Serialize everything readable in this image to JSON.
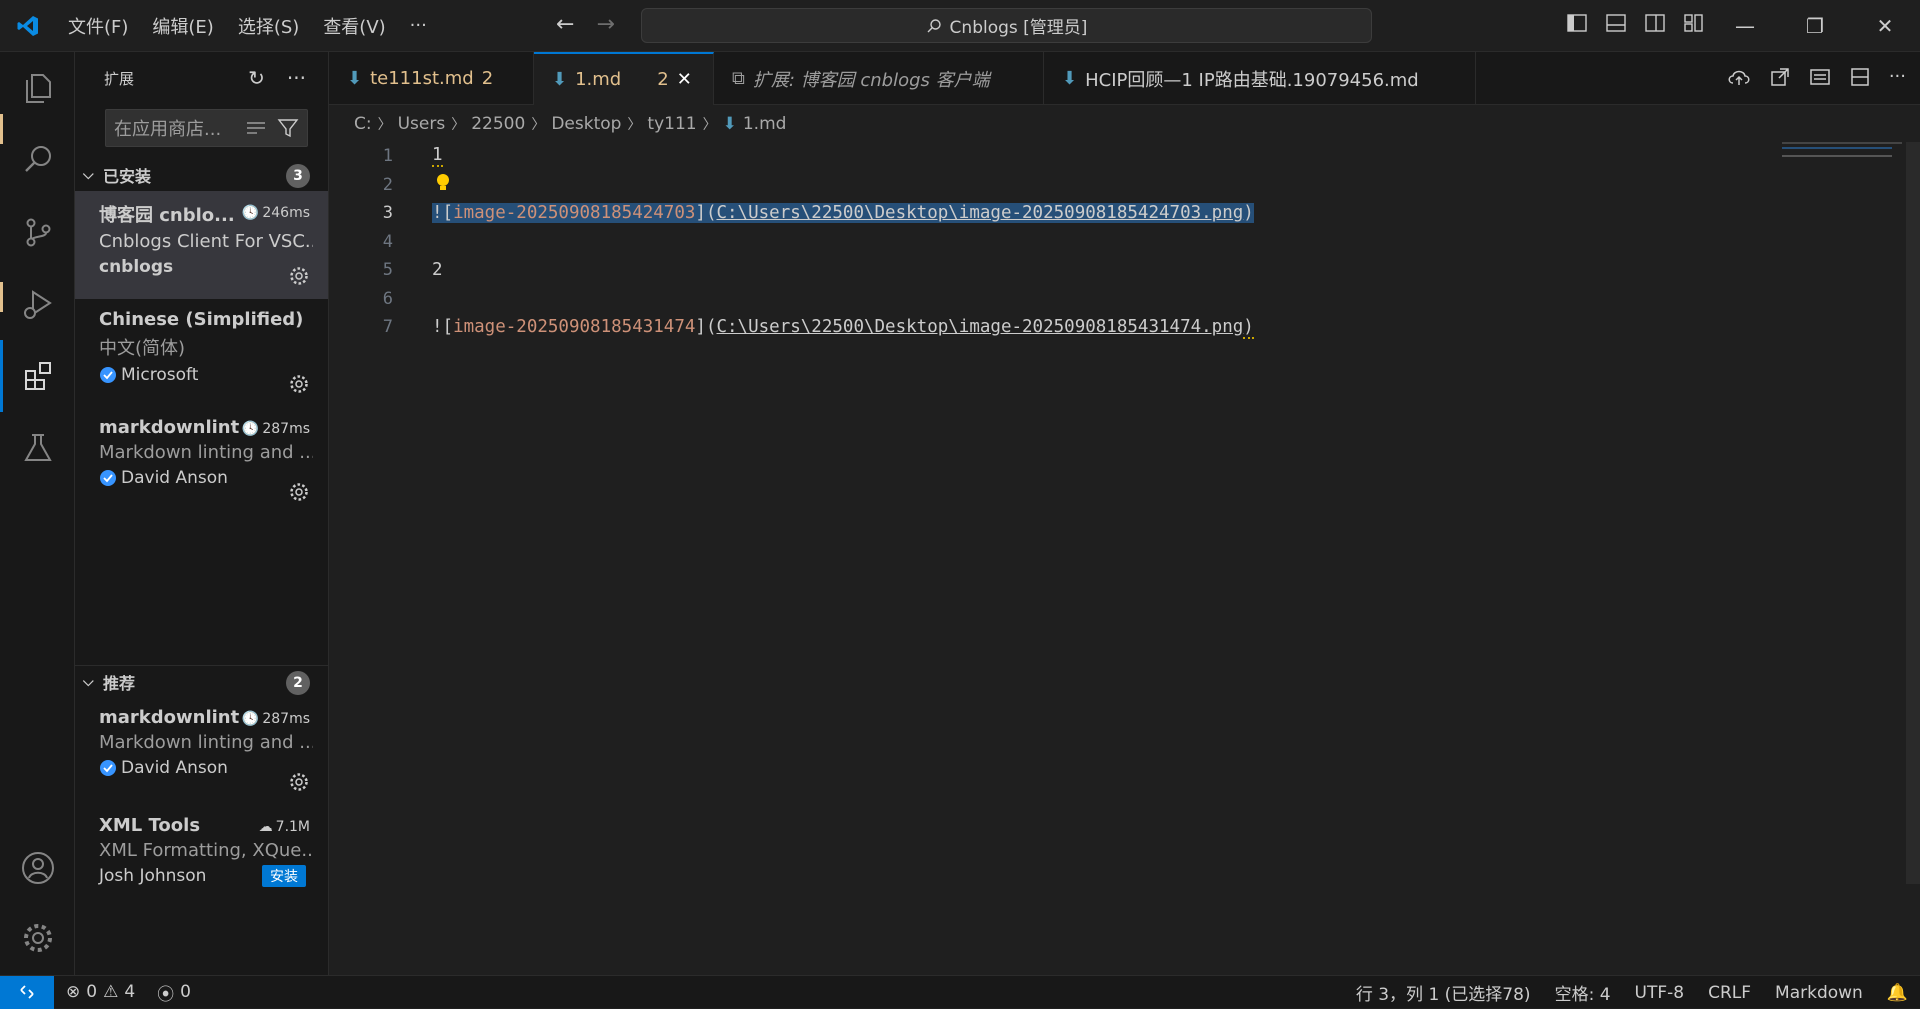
{
  "titlebar": {
    "menu": [
      "文件(F)",
      "编辑(E)",
      "选择(S)",
      "查看(V)",
      "···"
    ],
    "command_center": "Cnblogs [管理员]"
  },
  "sidebar": {
    "title": "扩展",
    "search_placeholder": "在应用商店...",
    "installed": {
      "label": "已安装",
      "count": "3",
      "items": [
        {
          "name": "博客园 cnblo...",
          "meta": "246ms",
          "desc": "Cnblogs Client For VSC...",
          "publisher": "cnblogs"
        },
        {
          "name": "Chinese (Simplified) ...",
          "meta": "",
          "desc": "中文(简体)",
          "publisher": "Microsoft"
        },
        {
          "name": "markdownlint",
          "meta": "287ms",
          "desc": "Markdown linting and ...",
          "publisher": "David Anson"
        }
      ]
    },
    "recommended": {
      "label": "推荐",
      "count": "2",
      "items": [
        {
          "name": "markdownlint",
          "meta": "287ms",
          "desc": "Markdown linting and ...",
          "publisher": "David Anson"
        },
        {
          "name": "XML Tools",
          "meta": "7.1M",
          "desc": "XML Formatting, XQue...",
          "publisher": "Josh Johnson",
          "install_label": "安装"
        }
      ]
    }
  },
  "tabs": [
    {
      "label": "te111st.md",
      "badge": "2"
    },
    {
      "label": "1.md",
      "badge": "2",
      "close": "✕"
    },
    {
      "label": "扩展: 博客园 cnblogs 客户端"
    },
    {
      "label": "HCIP回顾—1   IP路由基础.19079456.md"
    }
  ],
  "breadcrumb": [
    "C:",
    "Users",
    "22500",
    "Desktop",
    "ty111",
    "1.md"
  ],
  "editor": {
    "lines": [
      {
        "n": "1",
        "text": "1"
      },
      {
        "n": "2",
        "text": ""
      },
      {
        "n": "3",
        "alt": "image-20250908185424703",
        "path": "C:\\Users\\22500\\Desktop\\image-20250908185424703.png"
      },
      {
        "n": "4",
        "text": ""
      },
      {
        "n": "5",
        "text": "2"
      },
      {
        "n": "6",
        "text": ""
      },
      {
        "n": "7",
        "alt": "image-20250908185431474",
        "path": "C:\\Users\\22500\\Desktop\\image-20250908185431474.png"
      }
    ]
  },
  "statusbar": {
    "errors": "0",
    "warnings": "4",
    "ports": "0",
    "position": "行 3，列 1 (已选择78)",
    "spaces": "空格: 4",
    "encoding": "UTF-8",
    "eol": "CRLF",
    "language": "Markdown"
  }
}
